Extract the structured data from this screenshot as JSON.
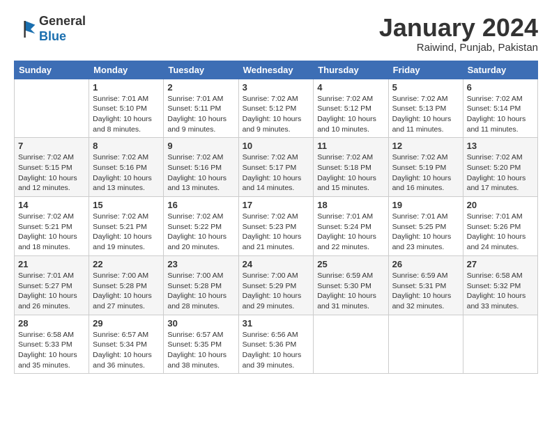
{
  "header": {
    "logo_general": "General",
    "logo_blue": "Blue",
    "month_title": "January 2024",
    "location": "Raiwind, Punjab, Pakistan"
  },
  "columns": [
    "Sunday",
    "Monday",
    "Tuesday",
    "Wednesday",
    "Thursday",
    "Friday",
    "Saturday"
  ],
  "weeks": [
    [
      {
        "day": "",
        "sunrise": "",
        "sunset": "",
        "daylight": ""
      },
      {
        "day": "1",
        "sunrise": "Sunrise: 7:01 AM",
        "sunset": "Sunset: 5:10 PM",
        "daylight": "Daylight: 10 hours and 8 minutes."
      },
      {
        "day": "2",
        "sunrise": "Sunrise: 7:01 AM",
        "sunset": "Sunset: 5:11 PM",
        "daylight": "Daylight: 10 hours and 9 minutes."
      },
      {
        "day": "3",
        "sunrise": "Sunrise: 7:02 AM",
        "sunset": "Sunset: 5:12 PM",
        "daylight": "Daylight: 10 hours and 9 minutes."
      },
      {
        "day": "4",
        "sunrise": "Sunrise: 7:02 AM",
        "sunset": "Sunset: 5:12 PM",
        "daylight": "Daylight: 10 hours and 10 minutes."
      },
      {
        "day": "5",
        "sunrise": "Sunrise: 7:02 AM",
        "sunset": "Sunset: 5:13 PM",
        "daylight": "Daylight: 10 hours and 11 minutes."
      },
      {
        "day": "6",
        "sunrise": "Sunrise: 7:02 AM",
        "sunset": "Sunset: 5:14 PM",
        "daylight": "Daylight: 10 hours and 11 minutes."
      }
    ],
    [
      {
        "day": "7",
        "sunrise": "Sunrise: 7:02 AM",
        "sunset": "Sunset: 5:15 PM",
        "daylight": "Daylight: 10 hours and 12 minutes."
      },
      {
        "day": "8",
        "sunrise": "Sunrise: 7:02 AM",
        "sunset": "Sunset: 5:16 PM",
        "daylight": "Daylight: 10 hours and 13 minutes."
      },
      {
        "day": "9",
        "sunrise": "Sunrise: 7:02 AM",
        "sunset": "Sunset: 5:16 PM",
        "daylight": "Daylight: 10 hours and 13 minutes."
      },
      {
        "day": "10",
        "sunrise": "Sunrise: 7:02 AM",
        "sunset": "Sunset: 5:17 PM",
        "daylight": "Daylight: 10 hours and 14 minutes."
      },
      {
        "day": "11",
        "sunrise": "Sunrise: 7:02 AM",
        "sunset": "Sunset: 5:18 PM",
        "daylight": "Daylight: 10 hours and 15 minutes."
      },
      {
        "day": "12",
        "sunrise": "Sunrise: 7:02 AM",
        "sunset": "Sunset: 5:19 PM",
        "daylight": "Daylight: 10 hours and 16 minutes."
      },
      {
        "day": "13",
        "sunrise": "Sunrise: 7:02 AM",
        "sunset": "Sunset: 5:20 PM",
        "daylight": "Daylight: 10 hours and 17 minutes."
      }
    ],
    [
      {
        "day": "14",
        "sunrise": "Sunrise: 7:02 AM",
        "sunset": "Sunset: 5:21 PM",
        "daylight": "Daylight: 10 hours and 18 minutes."
      },
      {
        "day": "15",
        "sunrise": "Sunrise: 7:02 AM",
        "sunset": "Sunset: 5:21 PM",
        "daylight": "Daylight: 10 hours and 19 minutes."
      },
      {
        "day": "16",
        "sunrise": "Sunrise: 7:02 AM",
        "sunset": "Sunset: 5:22 PM",
        "daylight": "Daylight: 10 hours and 20 minutes."
      },
      {
        "day": "17",
        "sunrise": "Sunrise: 7:02 AM",
        "sunset": "Sunset: 5:23 PM",
        "daylight": "Daylight: 10 hours and 21 minutes."
      },
      {
        "day": "18",
        "sunrise": "Sunrise: 7:01 AM",
        "sunset": "Sunset: 5:24 PM",
        "daylight": "Daylight: 10 hours and 22 minutes."
      },
      {
        "day": "19",
        "sunrise": "Sunrise: 7:01 AM",
        "sunset": "Sunset: 5:25 PM",
        "daylight": "Daylight: 10 hours and 23 minutes."
      },
      {
        "day": "20",
        "sunrise": "Sunrise: 7:01 AM",
        "sunset": "Sunset: 5:26 PM",
        "daylight": "Daylight: 10 hours and 24 minutes."
      }
    ],
    [
      {
        "day": "21",
        "sunrise": "Sunrise: 7:01 AM",
        "sunset": "Sunset: 5:27 PM",
        "daylight": "Daylight: 10 hours and 26 minutes."
      },
      {
        "day": "22",
        "sunrise": "Sunrise: 7:00 AM",
        "sunset": "Sunset: 5:28 PM",
        "daylight": "Daylight: 10 hours and 27 minutes."
      },
      {
        "day": "23",
        "sunrise": "Sunrise: 7:00 AM",
        "sunset": "Sunset: 5:28 PM",
        "daylight": "Daylight: 10 hours and 28 minutes."
      },
      {
        "day": "24",
        "sunrise": "Sunrise: 7:00 AM",
        "sunset": "Sunset: 5:29 PM",
        "daylight": "Daylight: 10 hours and 29 minutes."
      },
      {
        "day": "25",
        "sunrise": "Sunrise: 6:59 AM",
        "sunset": "Sunset: 5:30 PM",
        "daylight": "Daylight: 10 hours and 31 minutes."
      },
      {
        "day": "26",
        "sunrise": "Sunrise: 6:59 AM",
        "sunset": "Sunset: 5:31 PM",
        "daylight": "Daylight: 10 hours and 32 minutes."
      },
      {
        "day": "27",
        "sunrise": "Sunrise: 6:58 AM",
        "sunset": "Sunset: 5:32 PM",
        "daylight": "Daylight: 10 hours and 33 minutes."
      }
    ],
    [
      {
        "day": "28",
        "sunrise": "Sunrise: 6:58 AM",
        "sunset": "Sunset: 5:33 PM",
        "daylight": "Daylight: 10 hours and 35 minutes."
      },
      {
        "day": "29",
        "sunrise": "Sunrise: 6:57 AM",
        "sunset": "Sunset: 5:34 PM",
        "daylight": "Daylight: 10 hours and 36 minutes."
      },
      {
        "day": "30",
        "sunrise": "Sunrise: 6:57 AM",
        "sunset": "Sunset: 5:35 PM",
        "daylight": "Daylight: 10 hours and 38 minutes."
      },
      {
        "day": "31",
        "sunrise": "Sunrise: 6:56 AM",
        "sunset": "Sunset: 5:36 PM",
        "daylight": "Daylight: 10 hours and 39 minutes."
      },
      {
        "day": "",
        "sunrise": "",
        "sunset": "",
        "daylight": ""
      },
      {
        "day": "",
        "sunrise": "",
        "sunset": "",
        "daylight": ""
      },
      {
        "day": "",
        "sunrise": "",
        "sunset": "",
        "daylight": ""
      }
    ]
  ]
}
